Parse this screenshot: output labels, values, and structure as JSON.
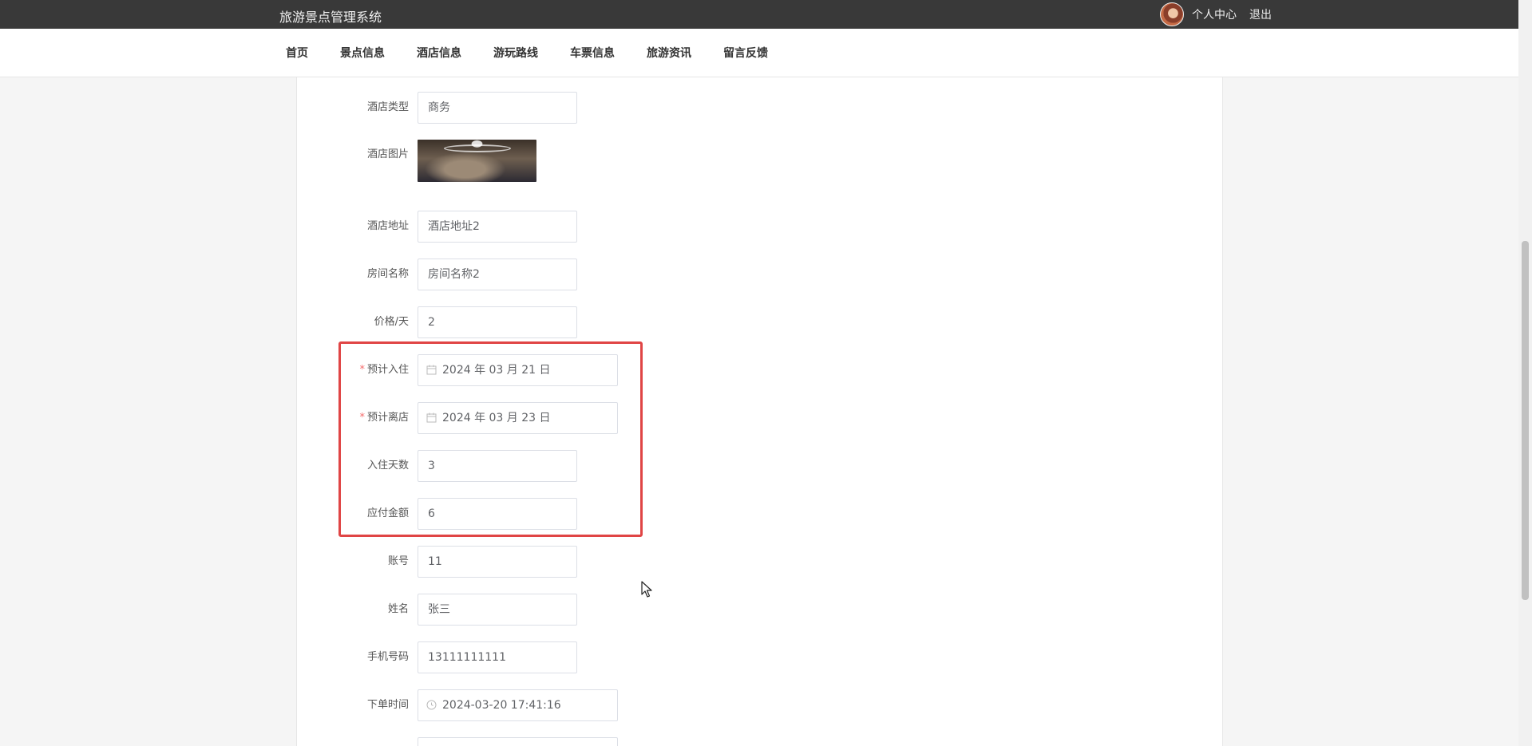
{
  "header": {
    "system_title": "旅游景点管理系统",
    "user_center": "个人中心",
    "logout": "退出"
  },
  "nav": {
    "items": [
      {
        "label": "首页"
      },
      {
        "label": "景点信息"
      },
      {
        "label": "酒店信息"
      },
      {
        "label": "游玩路线"
      },
      {
        "label": "车票信息"
      },
      {
        "label": "旅游资讯"
      },
      {
        "label": "留言反馈"
      }
    ]
  },
  "form": {
    "hotel_type": {
      "label": "酒店类型",
      "value": "商务"
    },
    "hotel_image": {
      "label": "酒店图片"
    },
    "hotel_address": {
      "label": "酒店地址",
      "value": "酒店地址2"
    },
    "room_name": {
      "label": "房间名称",
      "value": "房间名称2"
    },
    "price_per_day": {
      "label": "价格/天",
      "value": "2"
    },
    "checkin_date": {
      "label": "预计入住",
      "required_mark": "*",
      "value": "2024 年 03 月 21 日"
    },
    "checkout_date": {
      "label": "预计离店",
      "required_mark": "*",
      "value": "2024 年 03 月 23 日"
    },
    "stay_days": {
      "label": "入住天数",
      "value": "3"
    },
    "amount_due": {
      "label": "应付金额",
      "value": "6"
    },
    "account": {
      "label": "账号",
      "value": "11"
    },
    "name": {
      "label": "姓名",
      "value": "张三"
    },
    "phone": {
      "label": "手机号码",
      "value": "13111111111"
    },
    "order_time": {
      "label": "下单时间",
      "value": "2024-03-20 17:41:16"
    }
  },
  "colors": {
    "topbar": "#393939",
    "highlight_box": "#e04545",
    "required_star": "#f56c6c"
  },
  "icons": {
    "date_icon": "calendar-icon",
    "time_icon": "clock-icon"
  }
}
